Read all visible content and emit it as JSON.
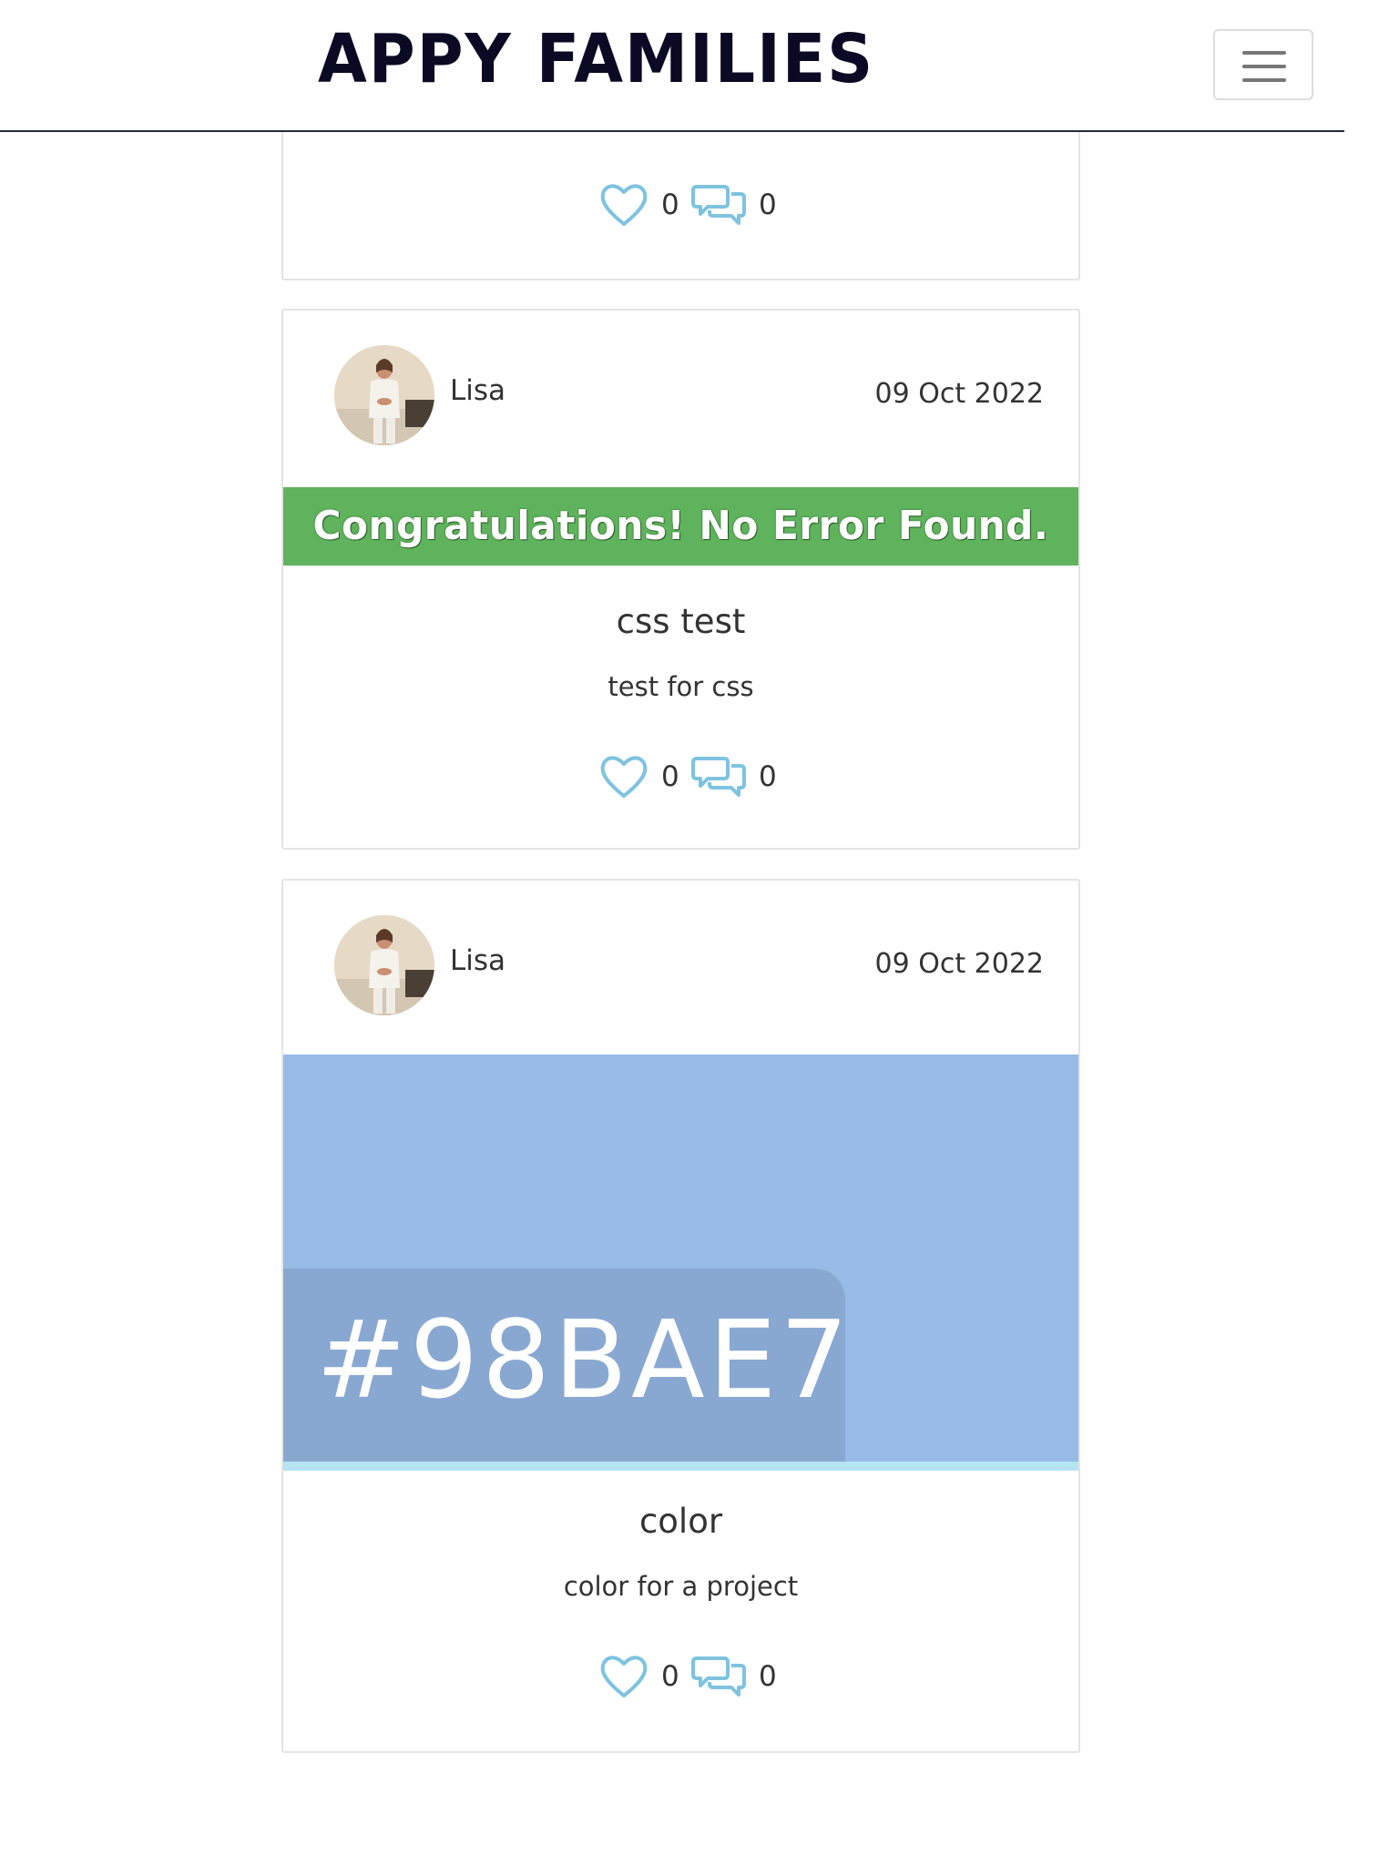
{
  "header": {
    "brand": "APPY FAMILIES",
    "menu_icon": "hamburger-menu-icon"
  },
  "posts": [
    {
      "likes": "0",
      "comments": "0"
    },
    {
      "author": "Lisa",
      "date": "09 Oct 2022",
      "image_text": "Congratulations! No Error Found.",
      "title": "css test",
      "body": "test for css",
      "likes": "0",
      "comments": "0"
    },
    {
      "author": "Lisa",
      "date": "09 Oct 2022",
      "image_text": "#98BAE7",
      "title": "color",
      "body": "color for a project",
      "likes": "0",
      "comments": "0"
    }
  ],
  "colors": {
    "brand": "#0a0a24",
    "accent_icons": "#7ec3e0",
    "banner_green": "#5fb35c",
    "swatch": "#98bae7"
  },
  "icons": {
    "like": "heart-icon",
    "comment": "comments-icon"
  }
}
